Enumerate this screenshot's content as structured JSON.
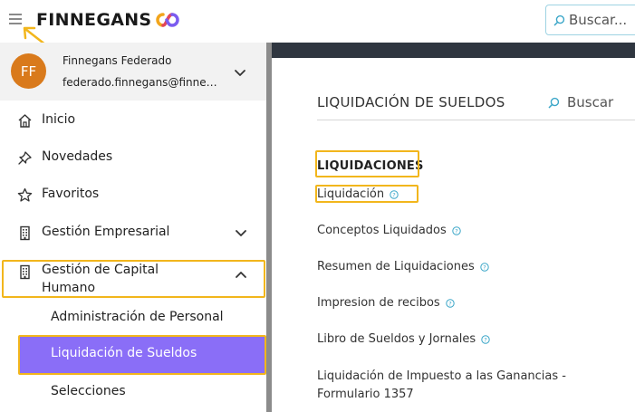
{
  "header": {
    "logo_text": "FINNEGANS",
    "search_placeholder": "Buscar..."
  },
  "user": {
    "initials": "FF",
    "name": "Finnegans Federado",
    "email": "federado.finnegans@finnegans.com.ar",
    "avatar_color": "#d97a1c"
  },
  "sidebar": {
    "items": [
      {
        "label": "Inicio",
        "icon": "home-icon"
      },
      {
        "label": "Novedades",
        "icon": "pin-icon"
      },
      {
        "label": "Favoritos",
        "icon": "star-icon"
      },
      {
        "label": "Gestión Empresarial",
        "icon": "building-icon"
      },
      {
        "label": "Gestión de Capital Humano",
        "icon": "building-icon"
      }
    ],
    "subitems": [
      {
        "label": "Administración de Personal"
      },
      {
        "label": "Liquidación de Sueldos"
      },
      {
        "label": "Selecciones"
      }
    ],
    "active_color": "#8a6ef7"
  },
  "main": {
    "title": "LIQUIDACIÓN DE SUELDOS",
    "search_placeholder": "Buscar",
    "section_title": "LIQUIDACIONES",
    "links": [
      {
        "label": "Liquidación"
      },
      {
        "label": "Conceptos Liquidados"
      },
      {
        "label": "Resumen de Liquidaciones"
      },
      {
        "label": "Impresion de recibos"
      },
      {
        "label": "Libro de Sueldos y Jornales"
      },
      {
        "label": "Liquidación de Impuesto a las Ganancias - Formulario 1357"
      }
    ]
  },
  "colors": {
    "highlight": "#f2b61c",
    "topbar_dark": "#2f3640",
    "search_border": "#9ed3e3"
  }
}
